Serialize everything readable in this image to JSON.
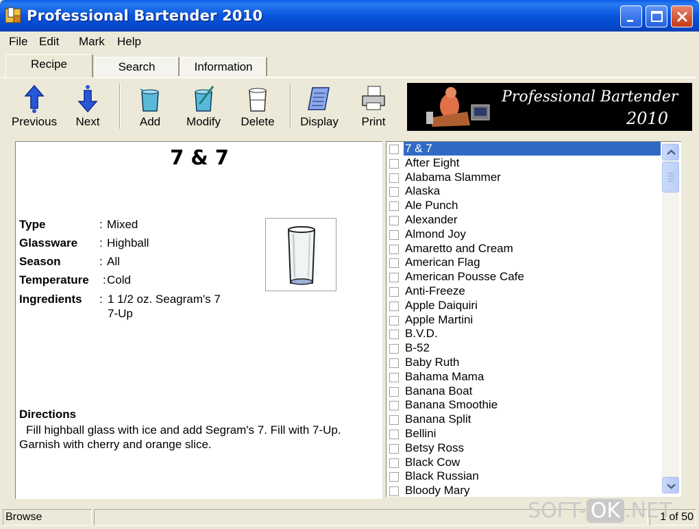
{
  "window": {
    "title": "Professional Bartender 2010"
  },
  "menu": [
    "File",
    "Edit",
    "Mark",
    "Help"
  ],
  "tabs": [
    {
      "label": "Recipe",
      "active": true
    },
    {
      "label": "Search",
      "active": false
    },
    {
      "label": "Information",
      "active": false
    }
  ],
  "toolbar": {
    "previous": "Previous",
    "next": "Next",
    "add": "Add",
    "modify": "Modify",
    "delete": "Delete",
    "display": "Display",
    "print": "Print"
  },
  "banner": {
    "line1": "Professional Bartender",
    "line2": "2010"
  },
  "recipe": {
    "name": "7 & 7",
    "fields": {
      "type_label": "Type",
      "type": "Mixed",
      "glassware_label": "Glassware",
      "glassware": "Highball",
      "season_label": "Season",
      "season": "All",
      "temperature_label": "Temperature",
      "temperature": "Cold",
      "ingredients_label": "Ingredients",
      "ingredients": [
        "1 1/2 oz. Seagram's 7",
        "7-Up"
      ]
    },
    "directions_label": "Directions",
    "directions": "Fill highball glass with ice and add Segram's 7.  Fill with 7-Up. Garnish with cherry and orange slice."
  },
  "list": {
    "selected": "7 & 7",
    "items": [
      "7 & 7",
      "After Eight",
      "Alabama Slammer",
      "Alaska",
      "Ale Punch",
      "Alexander",
      "Almond Joy",
      "Amaretto and Cream",
      "American Flag",
      "American Pousse Cafe",
      "Anti-Freeze",
      "Apple Daiquiri",
      "Apple Martini",
      "B.V.D.",
      "B-52",
      "Baby Ruth",
      "Bahama Mama",
      "Banana Boat",
      "Banana Smoothie",
      "Banana Split",
      "Bellini",
      "Betsy Ross",
      "Black Cow",
      "Black Russian",
      "Bloody Mary"
    ]
  },
  "status": {
    "mode": "Browse",
    "count": "1 of 50"
  },
  "watermark": {
    "left": "SOFT-",
    "ok": "OK",
    "right": ".NET"
  },
  "colors": {
    "titlebar": "#0855dd",
    "selection": "#316ac5",
    "chrome": "#ece9d8"
  }
}
